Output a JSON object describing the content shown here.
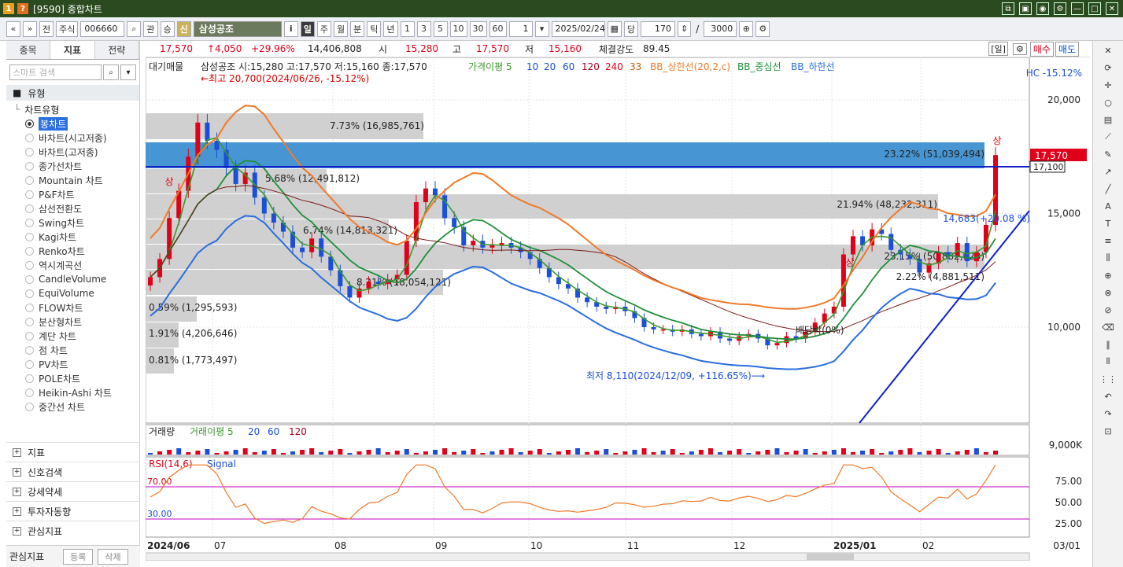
{
  "window": {
    "title": "[9590] 종합차트",
    "icon_a": "1",
    "icon_b": "?"
  },
  "toolbar": {
    "nav_prev": "«",
    "nav_down": "»",
    "jeon": "전",
    "market": "주식",
    "code": "006660",
    "gwan": "관",
    "sang": "승",
    "sin": "신",
    "stock_name": "삼성공조",
    "info": "i",
    "periods": [
      "일",
      "주",
      "월",
      "분",
      "틱",
      "년"
    ],
    "counts": [
      "1",
      "3",
      "5",
      "10",
      "30",
      "60"
    ],
    "unit": "1",
    "date": "2025/02/24",
    "dang": "당",
    "bars": "170",
    "slash": "/",
    "total": "3000"
  },
  "left": {
    "tabs": [
      "종목",
      "지표",
      "전략"
    ],
    "search_placeholder": "스마트 검색",
    "category": "유형",
    "subcategory": "차트유형",
    "chart_types": [
      "봉차트",
      "바차트(시고저종)",
      "바차트(고저종)",
      "종가선차트",
      "Mountain 차트",
      "P&F차트",
      "삼선전환도",
      "Swing차트",
      "Kagi차트",
      "Renko차트",
      "역시계곡선",
      "CandleVolume",
      "EquiVolume",
      "FLOW차트",
      "분산형차트",
      "계단 차트",
      "점 차트",
      "PV차트",
      "POLE차트",
      "Heikin-Ashi 차트",
      "중간선 차트"
    ],
    "sections": [
      "지표",
      "신호검색",
      "강세약세",
      "투자자동향",
      "관심지표"
    ],
    "bottom_label": "관심지표",
    "bottom_buttons": [
      "등록",
      "삭제"
    ]
  },
  "quote": {
    "price": "17,570",
    "change": "↑4,050",
    "pct": "+29.96%",
    "volume": "14,406,808",
    "open_l": "시",
    "open": "15,280",
    "high_l": "고",
    "high": "17,570",
    "low_l": "저",
    "low": "15,160",
    "str_l": "체결강도",
    "str": "89.45",
    "day": "[일]",
    "buy": "매수",
    "sell": "매도"
  },
  "legend": {
    "main": "대기매물",
    "stock": "삼성공조 시:15,280 고:17,570 저:15,160 종:17,570",
    "ma_label": "가격이평 5",
    "ma": [
      "10",
      "20",
      "60",
      "120",
      "240",
      "33"
    ],
    "bb_up": "BB_상한선(20,2,c)",
    "bb_mid": "BB_중심선",
    "bb_low": "BB_하한선",
    "hc": "HC -15.12%"
  },
  "annotations": {
    "high": "←최고 20,700(2024/06/26, -15.12%)",
    "low": "최저 8,110(2024/12/09, +116.65%)⟶",
    "pivot": "14,683(+20.08 %)",
    "dividend": "배당락(0%)",
    "sang1": "상",
    "sang2": "상",
    "sang3": "상"
  },
  "supply_zones": [
    "7.73% (16,985,761)",
    "23.22% (51,039,494)",
    "5.68% (12,491,812)",
    "21.94% (48,232,311)",
    "6.74% (14,813,321)",
    "23.15% (50,882,923)",
    "8.21% (18,054,121)",
    "2.22% (4,881,511)",
    "0.59% (1,295,593)",
    "1.91% (4,206,646)",
    "0.81% (1,773,497)"
  ],
  "price_axis": [
    "20,000",
    "15,000",
    "10,000"
  ],
  "price_tags": {
    "current": "17,570",
    "cross": "17,100"
  },
  "volume": {
    "title": "거래량",
    "ma_label": "거래이평 5",
    "ma": [
      "20",
      "60",
      "120"
    ],
    "axis": "9,000K"
  },
  "rsi": {
    "title": "RSI(14,6)",
    "signal": "Signal",
    "over": "70.00",
    "under": "30.00",
    "axis": [
      "75.00",
      "50.00",
      "25.00"
    ]
  },
  "x_axis": [
    "2024/06",
    "07",
    "08",
    "09",
    "10",
    "11",
    "12",
    "2025/01",
    "02",
    "03/01"
  ],
  "colors": {
    "up": "#e0001a",
    "down": "#1b4fd8",
    "ma5": "#3a9a2a",
    "bb": "#f07a2a",
    "zone": "#c8c8c8",
    "zone_hi": "#3d8fd0"
  }
}
